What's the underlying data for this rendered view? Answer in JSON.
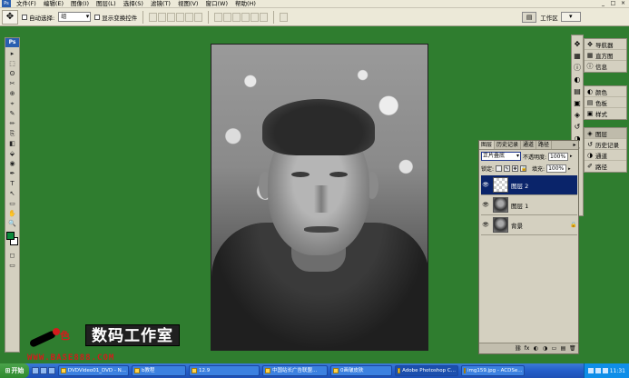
{
  "menubar": {
    "items": [
      "文件(F)",
      "编辑(E)",
      "图像(I)",
      "图层(L)",
      "选择(S)",
      "滤镜(T)",
      "视图(V)",
      "窗口(W)",
      "帮助(H)"
    ],
    "window_controls": [
      "_",
      "□",
      "×"
    ]
  },
  "optionsbar": {
    "auto_select_label": "自动选择:",
    "auto_select_value": "组",
    "show_transform_label": "显示变换控件",
    "workspace_label": "工作区"
  },
  "toolbox": {
    "logo": "Ps",
    "tools": [
      "▸",
      "⬚",
      "ʘ",
      "✂",
      "⊕",
      "⌖",
      "✎",
      "✏",
      "⎘",
      "◧",
      "⬙",
      "◉",
      "✒",
      "T",
      "↖",
      "▭",
      "✋",
      "🔍"
    ],
    "fg_color": "#0c8a3c",
    "bg_color": "#ffffff"
  },
  "dock": {
    "group1": [
      {
        "icon": "✥",
        "label": "导航器"
      },
      {
        "icon": "▦",
        "label": "直方图"
      },
      {
        "icon": "ⓘ",
        "label": "信息"
      }
    ],
    "group2": [
      {
        "icon": "◐",
        "label": "颜色"
      },
      {
        "icon": "▤",
        "label": "色板"
      },
      {
        "icon": "▣",
        "label": "样式"
      }
    ],
    "group3": [
      {
        "icon": "◈",
        "label": "图层"
      },
      {
        "icon": "↺",
        "label": "历史记录"
      },
      {
        "icon": "◑",
        "label": "通道"
      },
      {
        "icon": "✐",
        "label": "路径"
      }
    ]
  },
  "layers_panel": {
    "tabs": [
      "图层",
      "历史记录",
      "通道",
      "路径"
    ],
    "menu_arrow": "▸",
    "blend_mode": "正片叠底",
    "opacity_label": "不透明度:",
    "opacity": "100%",
    "lock_label": "锁定:",
    "fill_label": "填充:",
    "fill": "100%",
    "layers": [
      {
        "name": "图层 2",
        "visible": "👁",
        "lock": ""
      },
      {
        "name": "图层 1",
        "visible": "👁",
        "lock": ""
      },
      {
        "name": "背景",
        "visible": "👁",
        "lock": "🔒"
      }
    ],
    "footer_icons": [
      "⛓",
      "fx",
      "◐",
      "◑",
      "▭",
      "▤",
      "🗑"
    ]
  },
  "watermark": {
    "logo_char": "色",
    "title": "数码工作室",
    "website": "WWW.BASE888.COM"
  },
  "taskbar": {
    "start": "开始",
    "buttons": [
      {
        "label": "DVDVideo01_DVD - N..."
      },
      {
        "label": "b教程"
      },
      {
        "label": "12.9"
      },
      {
        "label": "中国站长广告联盟..."
      },
      {
        "label": "0画皱皮肤"
      },
      {
        "label": "Adobe Photoshop C..."
      },
      {
        "label": "img159.jpg - ACDSe..."
      }
    ],
    "clock": "11:31"
  }
}
